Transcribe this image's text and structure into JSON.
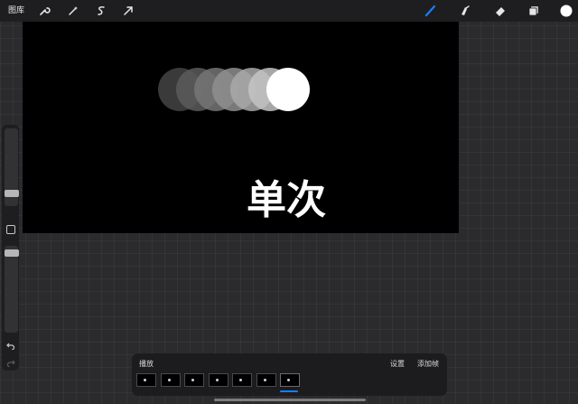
{
  "topbar": {
    "gallery_label": "图库",
    "left_tools": [
      "wrench-icon",
      "magic-wand-icon",
      "selection-icon",
      "transform-arrow-icon"
    ],
    "right_tools": [
      "brush-icon",
      "smudge-icon",
      "eraser-icon",
      "layers-icon",
      "color-swatch"
    ],
    "active_color": "#1a7dff",
    "current_color": "#ffffff"
  },
  "canvas": {
    "text": "单次",
    "circles": [
      {
        "fill": "#444444"
      },
      {
        "fill": "#5c5c5c"
      },
      {
        "fill": "#767676"
      },
      {
        "fill": "#8f8f8f"
      },
      {
        "fill": "#a9a9a9"
      },
      {
        "fill": "#c4c4c4"
      },
      {
        "fill": "#ffffff"
      }
    ]
  },
  "timeline": {
    "play_label": "播放",
    "settings_label": "设置",
    "add_frame_label": "添加帧",
    "frame_count": 7,
    "active_frame": 7
  }
}
